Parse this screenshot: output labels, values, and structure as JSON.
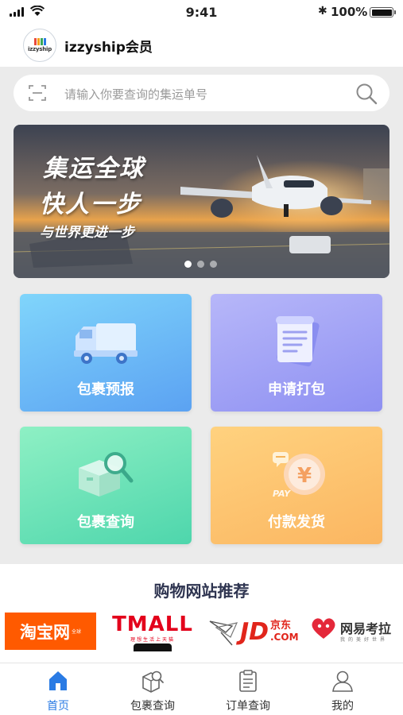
{
  "status_bar": {
    "time": "9:41",
    "battery": "100%"
  },
  "header": {
    "logo_text": "izzyship",
    "title": "izzyship会员"
  },
  "search": {
    "placeholder": "请输入你要查询的集运单号"
  },
  "banner": {
    "headline_1": "集运全球",
    "headline_2": "快人一步",
    "tagline": "与世界更进一步",
    "slide_count": 3,
    "active_slide": 1
  },
  "tiles": [
    {
      "label": "包裹预报",
      "icon": "truck-icon"
    },
    {
      "label": "申请打包",
      "icon": "document-icon"
    },
    {
      "label": "包裹查询",
      "icon": "box-search-icon"
    },
    {
      "label": "付款发货",
      "icon": "yen-coin-icon"
    }
  ],
  "shopping": {
    "title": "购物网站推荐",
    "sites": [
      {
        "name": "淘宝网",
        "sub": "全球"
      },
      {
        "name": "TMALL",
        "sub": "理想生活上天猫"
      },
      {
        "name": "JD",
        "cn": "京东",
        "com": ".COM"
      },
      {
        "name": "网易考拉",
        "sub": "我的美好世界"
      }
    ]
  },
  "tabbar": [
    {
      "label": "首页",
      "icon": "home-icon",
      "active": true
    },
    {
      "label": "包裹查询",
      "icon": "package-search-icon",
      "active": false
    },
    {
      "label": "订单查询",
      "icon": "clipboard-icon",
      "active": false
    },
    {
      "label": "我的",
      "icon": "user-icon",
      "active": false
    }
  ],
  "colors": {
    "accent": "#2a7be4",
    "taobao": "#ff5a00",
    "tmall": "#e3001b",
    "jd": "#e1251b"
  }
}
